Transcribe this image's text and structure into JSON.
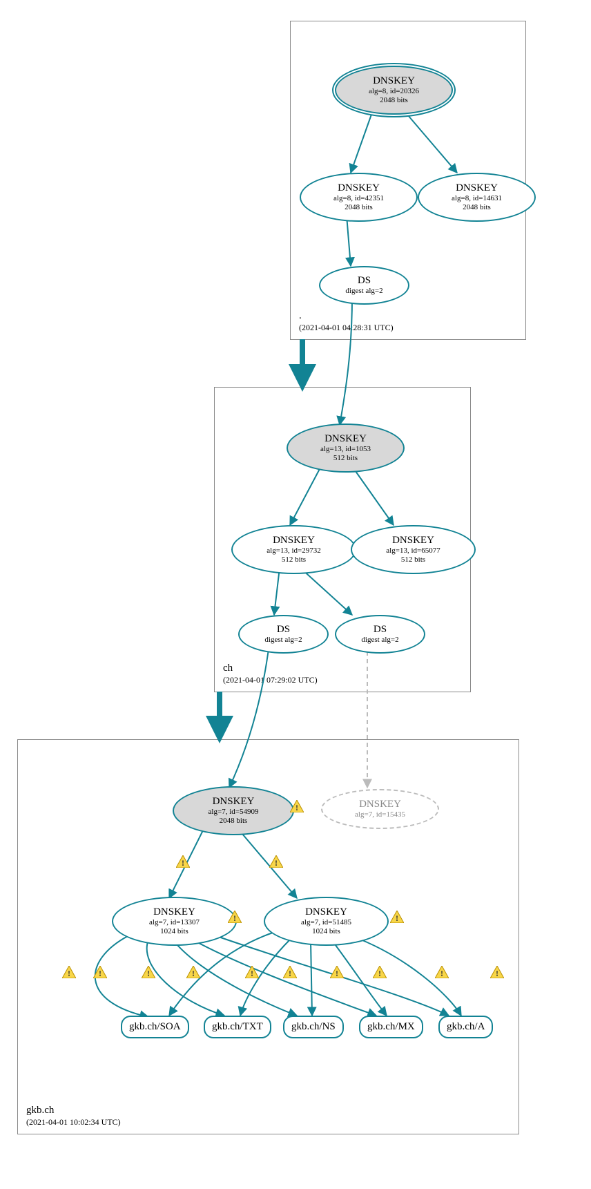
{
  "zones": {
    "root": {
      "name": ".",
      "timestamp": "(2021-04-01 04:28:31 UTC)"
    },
    "ch": {
      "name": "ch",
      "timestamp": "(2021-04-01 07:29:02 UTC)"
    },
    "gkb": {
      "name": "gkb.ch",
      "timestamp": "(2021-04-01 10:02:34 UTC)"
    }
  },
  "nodes": {
    "root_ksk": {
      "title": "DNSKEY",
      "line1": "alg=8, id=20326",
      "line2": "2048 bits"
    },
    "root_zsk1": {
      "title": "DNSKEY",
      "line1": "alg=8, id=42351",
      "line2": "2048 bits"
    },
    "root_zsk2": {
      "title": "DNSKEY",
      "line1": "alg=8, id=14631",
      "line2": "2048 bits"
    },
    "root_ds": {
      "title": "DS",
      "line1": "digest alg=2"
    },
    "ch_ksk": {
      "title": "DNSKEY",
      "line1": "alg=13, id=1053",
      "line2": "512 bits"
    },
    "ch_zsk1": {
      "title": "DNSKEY",
      "line1": "alg=13, id=29732",
      "line2": "512 bits"
    },
    "ch_zsk2": {
      "title": "DNSKEY",
      "line1": "alg=13, id=65077",
      "line2": "512 bits"
    },
    "ch_ds1": {
      "title": "DS",
      "line1": "digest alg=2"
    },
    "ch_ds2": {
      "title": "DS",
      "line1": "digest alg=2"
    },
    "gkb_ksk": {
      "title": "DNSKEY",
      "line1": "alg=7, id=54909",
      "line2": "2048 bits"
    },
    "gkb_miss": {
      "title": "DNSKEY",
      "line1": "alg=7, id=15435"
    },
    "gkb_zsk1": {
      "title": "DNSKEY",
      "line1": "alg=7, id=13307",
      "line2": "1024 bits"
    },
    "gkb_zsk2": {
      "title": "DNSKEY",
      "line1": "alg=7, id=51485",
      "line2": "1024 bits"
    },
    "rr_soa": {
      "title": "gkb.ch/SOA"
    },
    "rr_txt": {
      "title": "gkb.ch/TXT"
    },
    "rr_ns": {
      "title": "gkb.ch/NS"
    },
    "rr_mx": {
      "title": "gkb.ch/MX"
    },
    "rr_a": {
      "title": "gkb.ch/A"
    }
  },
  "colors": {
    "stroke": "#128394",
    "fill": "#d8d8d8",
    "warn_fill": "#f8d649",
    "warn_stroke": "#b98f00"
  }
}
